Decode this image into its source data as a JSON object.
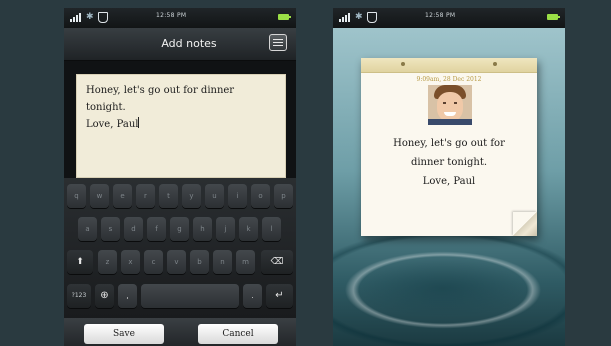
{
  "left_screen": {
    "status": {
      "time": "12:58 PM"
    },
    "header": {
      "title": "Add notes"
    },
    "note": {
      "lines": [
        "Honey, let's go out for dinner",
        "tonight.",
        "Love, Paul"
      ]
    },
    "keyboard": {
      "row1": [
        "q",
        "w",
        "e",
        "r",
        "t",
        "y",
        "u",
        "i",
        "o",
        "p"
      ],
      "row2": [
        "a",
        "s",
        "d",
        "f",
        "g",
        "h",
        "j",
        "k",
        "l"
      ],
      "row3": [
        "z",
        "x",
        "c",
        "v",
        "b",
        "n",
        "m"
      ],
      "row4": {
        "numbers": "?123",
        "comma": ",",
        "period": "."
      }
    },
    "actions": {
      "save": "Save",
      "cancel": "Cancel"
    }
  },
  "right_screen": {
    "status": {
      "time": "12:58 PM"
    },
    "sticky_note": {
      "datetime": "9:09am, 28 Dec 2012",
      "lines": [
        "Honey, let's go out for",
        "dinner tonight.",
        "Love, Paul"
      ]
    }
  },
  "colors": {
    "background": "#2a3a40",
    "battery": "#9bdf46",
    "note_paper": "#f1ecd9"
  }
}
